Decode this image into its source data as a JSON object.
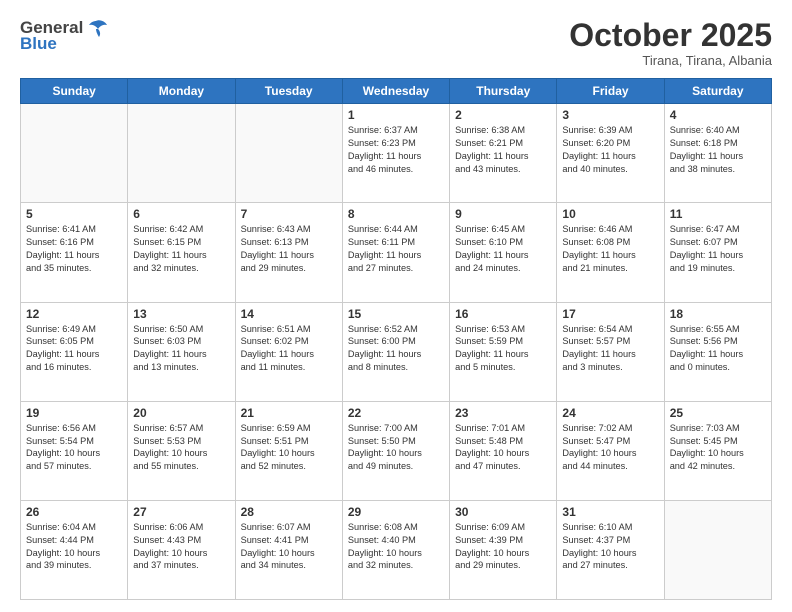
{
  "header": {
    "logo_general": "General",
    "logo_blue": "Blue",
    "month_title": "October 2025",
    "subtitle": "Tirana, Tirana, Albania"
  },
  "days_of_week": [
    "Sunday",
    "Monday",
    "Tuesday",
    "Wednesday",
    "Thursday",
    "Friday",
    "Saturday"
  ],
  "weeks": [
    [
      {
        "day": "",
        "info": ""
      },
      {
        "day": "",
        "info": ""
      },
      {
        "day": "",
        "info": ""
      },
      {
        "day": "1",
        "info": "Sunrise: 6:37 AM\nSunset: 6:23 PM\nDaylight: 11 hours\nand 46 minutes."
      },
      {
        "day": "2",
        "info": "Sunrise: 6:38 AM\nSunset: 6:21 PM\nDaylight: 11 hours\nand 43 minutes."
      },
      {
        "day": "3",
        "info": "Sunrise: 6:39 AM\nSunset: 6:20 PM\nDaylight: 11 hours\nand 40 minutes."
      },
      {
        "day": "4",
        "info": "Sunrise: 6:40 AM\nSunset: 6:18 PM\nDaylight: 11 hours\nand 38 minutes."
      }
    ],
    [
      {
        "day": "5",
        "info": "Sunrise: 6:41 AM\nSunset: 6:16 PM\nDaylight: 11 hours\nand 35 minutes."
      },
      {
        "day": "6",
        "info": "Sunrise: 6:42 AM\nSunset: 6:15 PM\nDaylight: 11 hours\nand 32 minutes."
      },
      {
        "day": "7",
        "info": "Sunrise: 6:43 AM\nSunset: 6:13 PM\nDaylight: 11 hours\nand 29 minutes."
      },
      {
        "day": "8",
        "info": "Sunrise: 6:44 AM\nSunset: 6:11 PM\nDaylight: 11 hours\nand 27 minutes."
      },
      {
        "day": "9",
        "info": "Sunrise: 6:45 AM\nSunset: 6:10 PM\nDaylight: 11 hours\nand 24 minutes."
      },
      {
        "day": "10",
        "info": "Sunrise: 6:46 AM\nSunset: 6:08 PM\nDaylight: 11 hours\nand 21 minutes."
      },
      {
        "day": "11",
        "info": "Sunrise: 6:47 AM\nSunset: 6:07 PM\nDaylight: 11 hours\nand 19 minutes."
      }
    ],
    [
      {
        "day": "12",
        "info": "Sunrise: 6:49 AM\nSunset: 6:05 PM\nDaylight: 11 hours\nand 16 minutes."
      },
      {
        "day": "13",
        "info": "Sunrise: 6:50 AM\nSunset: 6:03 PM\nDaylight: 11 hours\nand 13 minutes."
      },
      {
        "day": "14",
        "info": "Sunrise: 6:51 AM\nSunset: 6:02 PM\nDaylight: 11 hours\nand 11 minutes."
      },
      {
        "day": "15",
        "info": "Sunrise: 6:52 AM\nSunset: 6:00 PM\nDaylight: 11 hours\nand 8 minutes."
      },
      {
        "day": "16",
        "info": "Sunrise: 6:53 AM\nSunset: 5:59 PM\nDaylight: 11 hours\nand 5 minutes."
      },
      {
        "day": "17",
        "info": "Sunrise: 6:54 AM\nSunset: 5:57 PM\nDaylight: 11 hours\nand 3 minutes."
      },
      {
        "day": "18",
        "info": "Sunrise: 6:55 AM\nSunset: 5:56 PM\nDaylight: 11 hours\nand 0 minutes."
      }
    ],
    [
      {
        "day": "19",
        "info": "Sunrise: 6:56 AM\nSunset: 5:54 PM\nDaylight: 10 hours\nand 57 minutes."
      },
      {
        "day": "20",
        "info": "Sunrise: 6:57 AM\nSunset: 5:53 PM\nDaylight: 10 hours\nand 55 minutes."
      },
      {
        "day": "21",
        "info": "Sunrise: 6:59 AM\nSunset: 5:51 PM\nDaylight: 10 hours\nand 52 minutes."
      },
      {
        "day": "22",
        "info": "Sunrise: 7:00 AM\nSunset: 5:50 PM\nDaylight: 10 hours\nand 49 minutes."
      },
      {
        "day": "23",
        "info": "Sunrise: 7:01 AM\nSunset: 5:48 PM\nDaylight: 10 hours\nand 47 minutes."
      },
      {
        "day": "24",
        "info": "Sunrise: 7:02 AM\nSunset: 5:47 PM\nDaylight: 10 hours\nand 44 minutes."
      },
      {
        "day": "25",
        "info": "Sunrise: 7:03 AM\nSunset: 5:45 PM\nDaylight: 10 hours\nand 42 minutes."
      }
    ],
    [
      {
        "day": "26",
        "info": "Sunrise: 6:04 AM\nSunset: 4:44 PM\nDaylight: 10 hours\nand 39 minutes."
      },
      {
        "day": "27",
        "info": "Sunrise: 6:06 AM\nSunset: 4:43 PM\nDaylight: 10 hours\nand 37 minutes."
      },
      {
        "day": "28",
        "info": "Sunrise: 6:07 AM\nSunset: 4:41 PM\nDaylight: 10 hours\nand 34 minutes."
      },
      {
        "day": "29",
        "info": "Sunrise: 6:08 AM\nSunset: 4:40 PM\nDaylight: 10 hours\nand 32 minutes."
      },
      {
        "day": "30",
        "info": "Sunrise: 6:09 AM\nSunset: 4:39 PM\nDaylight: 10 hours\nand 29 minutes."
      },
      {
        "day": "31",
        "info": "Sunrise: 6:10 AM\nSunset: 4:37 PM\nDaylight: 10 hours\nand 27 minutes."
      },
      {
        "day": "",
        "info": ""
      }
    ]
  ]
}
